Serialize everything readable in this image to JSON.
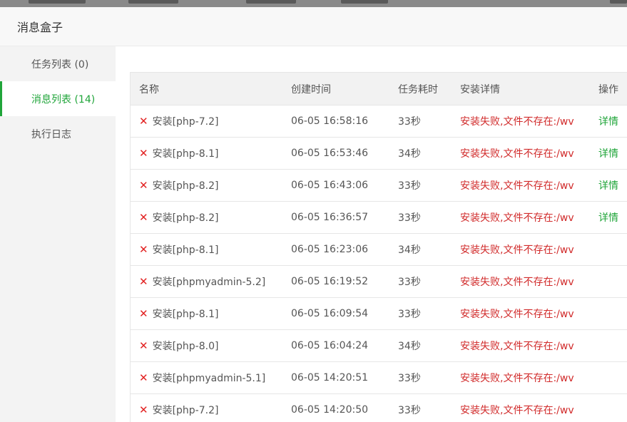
{
  "dialog": {
    "title": "消息盒子"
  },
  "sidebar": {
    "items": [
      {
        "label": "任务列表 (0)",
        "active": false
      },
      {
        "label": "消息列表 (14)",
        "active": true
      },
      {
        "label": "执行日志",
        "active": false
      }
    ]
  },
  "table": {
    "headers": {
      "name": "名称",
      "created": "创建时间",
      "duration": "任务耗时",
      "detail": "安装详情",
      "action": "操作"
    },
    "rows": [
      {
        "name": "安装[php-7.2]",
        "created": "06-05 16:58:16",
        "duration": "33秒",
        "detail": "安装失败,文件不存在:/wv",
        "action": "详情"
      },
      {
        "name": "安装[php-8.1]",
        "created": "06-05 16:53:46",
        "duration": "34秒",
        "detail": "安装失败,文件不存在:/wv",
        "action": "详情"
      },
      {
        "name": "安装[php-8.2]",
        "created": "06-05 16:43:06",
        "duration": "33秒",
        "detail": "安装失败,文件不存在:/wv",
        "action": "详情"
      },
      {
        "name": "安装[php-8.2]",
        "created": "06-05 16:36:57",
        "duration": "33秒",
        "detail": "安装失败,文件不存在:/wv",
        "action": "详情"
      },
      {
        "name": "安装[php-8.1]",
        "created": "06-05 16:23:06",
        "duration": "34秒",
        "detail": "安装失败,文件不存在:/wv",
        "action": ""
      },
      {
        "name": "安装[phpmyadmin-5.2]",
        "created": "06-05 16:19:52",
        "duration": "33秒",
        "detail": "安装失败,文件不存在:/wv",
        "action": ""
      },
      {
        "name": "安装[php-8.1]",
        "created": "06-05 16:09:54",
        "duration": "33秒",
        "detail": "安装失败,文件不存在:/wv",
        "action": ""
      },
      {
        "name": "安装[php-8.0]",
        "created": "06-05 16:04:24",
        "duration": "34秒",
        "detail": "安装失败,文件不存在:/wv",
        "action": ""
      },
      {
        "name": "安装[phpmyadmin-5.1]",
        "created": "06-05 14:20:51",
        "duration": "33秒",
        "detail": "安装失败,文件不存在:/wv",
        "action": ""
      },
      {
        "name": "安装[php-7.2]",
        "created": "06-05 14:20:50",
        "duration": "33秒",
        "detail": "安装失败,文件不存在:/wv",
        "action": ""
      }
    ]
  },
  "icons": {
    "status": "close-x-icon"
  },
  "colors": {
    "accent": "#20a53a",
    "error": "#d12b2b",
    "fail_icon": "#e22222"
  }
}
